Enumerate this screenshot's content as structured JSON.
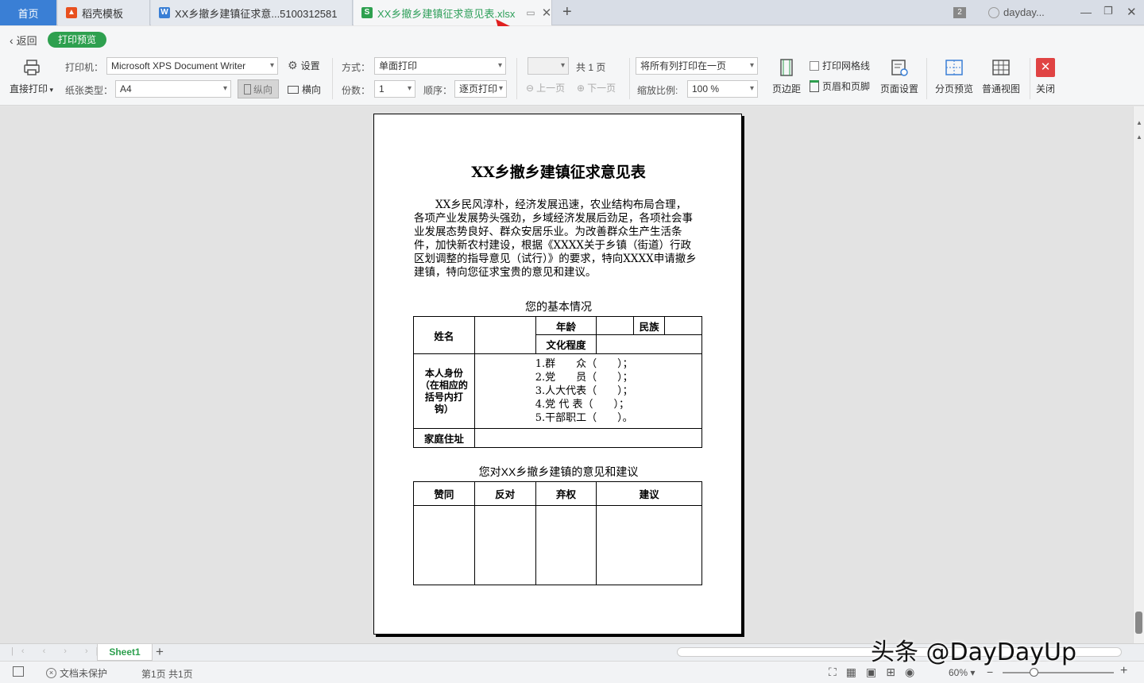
{
  "tabs": {
    "home": "首页",
    "daoke": "稻壳模板",
    "doc": "XX乡撤乡建镇征求意...5100312581",
    "xlsx": "XX乡撤乡建镇征求意见表.xlsx",
    "new_tab": "+",
    "badge": "2",
    "user": "dayday..."
  },
  "toolbar": {
    "back": "返回",
    "preview_pill": "打印预览",
    "direct_print": "直接打印",
    "printer_label": "打印机：",
    "printer_value": "Microsoft XPS Document Writer",
    "settings": "设置",
    "paper_label": "纸张类型：",
    "paper_value": "A4",
    "portrait": "纵向",
    "landscape": "横向",
    "mode_label": "方式：",
    "mode_value": "单面打印",
    "copies_label": "份数：",
    "copies_value": "1",
    "order_label": "顺序：",
    "order_value": "逐页打印",
    "page_total": "共 1 页",
    "prev_page": "上一页",
    "next_page": "下一页",
    "fit_value": "将所有列打印在一页",
    "zoom_label": "缩放比例:",
    "zoom_value": "100 %",
    "margins": "页边距",
    "gridlines": "打印网格线",
    "header_footer": "页眉和页脚",
    "page_setup": "页面设置",
    "page_break": "分页预览",
    "normal_view": "普通视图",
    "close": "关闭"
  },
  "document": {
    "title": "XX乡撤乡建镇征求意见表",
    "paragraph": "XX乡民风淳朴，经济发展迅速，农业结构布局合理，各项产业发展势头强劲，乡域经济发展后劲足，各项社会事业发展态势良好、群众安居乐业。为改善群众生产生活条件，加快新农村建设，根据《XXXX关于乡镇（街道）行政区划调整的指导意见（试行）》的要求，特向XXXX申请撤乡建镇，特向您征求宝贵的意见和建议。",
    "section1": "您的基本情况",
    "t1": {
      "name": "姓名",
      "age": "年龄",
      "ethnic": "民族",
      "education": "文化程度",
      "identity": "本人身份（在相应的括号内打钩）",
      "options": [
        "1.群　　众（　　）；",
        "2.党　　员（　　）；",
        "3.人大代表（　　）；",
        "4.党 代 表（　　）；",
        "5.干部职工（　　）。"
      ],
      "address": "家庭住址"
    },
    "section2": "您对XX乡撤乡建镇的意见和建议",
    "t2": {
      "agree": "赞同",
      "oppose": "反对",
      "abstain": "弃权",
      "suggest": "建议"
    }
  },
  "sheet": {
    "name": "Sheet1",
    "add": "+"
  },
  "status": {
    "protect": "文档未保护",
    "page_info": "第1页 共1页",
    "zoom": "60%"
  },
  "watermark": "头条 @DayDayUp",
  "colors": {
    "accent_green": "#2ea04f",
    "home_tab": "#3a7fd5",
    "close_red": "#e04343",
    "arrow_red": "#e02020"
  }
}
